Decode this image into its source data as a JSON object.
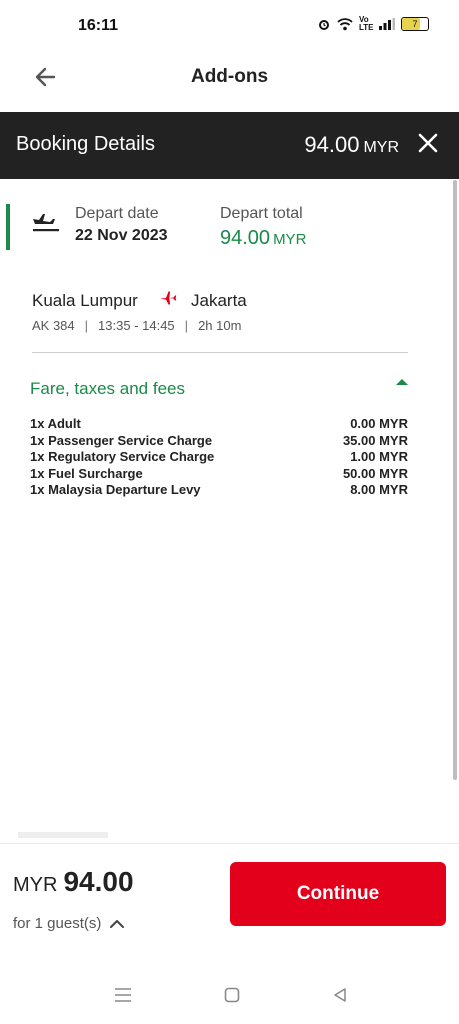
{
  "status_bar": {
    "time": "16:11",
    "icons": [
      "alarm-icon",
      "wifi-icon",
      "volte-icon",
      "signal-icon",
      "battery-icon"
    ],
    "volte_text": "Vo LTE",
    "battery_level": "7"
  },
  "header": {
    "title": "Add-ons",
    "back_icon": "arrow-left-icon"
  },
  "booking_bar": {
    "title": "Booking Details",
    "total_amount": "94.00",
    "currency": "MYR",
    "close_icon": "close-icon"
  },
  "depart": {
    "date_label": "Depart date",
    "date_value": "22 Nov 2023",
    "total_label": "Depart total",
    "total_amount": "94.00",
    "total_currency": "MYR"
  },
  "route": {
    "origin": "Kuala Lumpur",
    "destination": "Jakarta",
    "flight_no": "AK 384",
    "times": "13:35 - 14:45",
    "duration": "2h 10m"
  },
  "fees": {
    "title": "Fare, taxes and fees",
    "items": [
      {
        "label": "1x Adult",
        "amount": "0.00 MYR"
      },
      {
        "label": "1x Passenger Service Charge",
        "amount": "35.00 MYR"
      },
      {
        "label": "1x Regulatory Service Charge",
        "amount": "1.00 MYR"
      },
      {
        "label": "1x Fuel Surcharge",
        "amount": "50.00 MYR"
      },
      {
        "label": "1x Malaysia Departure Levy",
        "amount": "8.00 MYR"
      }
    ]
  },
  "footer": {
    "currency": "MYR",
    "amount": "94.00",
    "guests": "for 1 guest(s)",
    "continue_label": "Continue"
  },
  "colors": {
    "accent_green": "#1a8a4a",
    "primary_red": "#e3001b",
    "bar_dark": "#222222"
  }
}
